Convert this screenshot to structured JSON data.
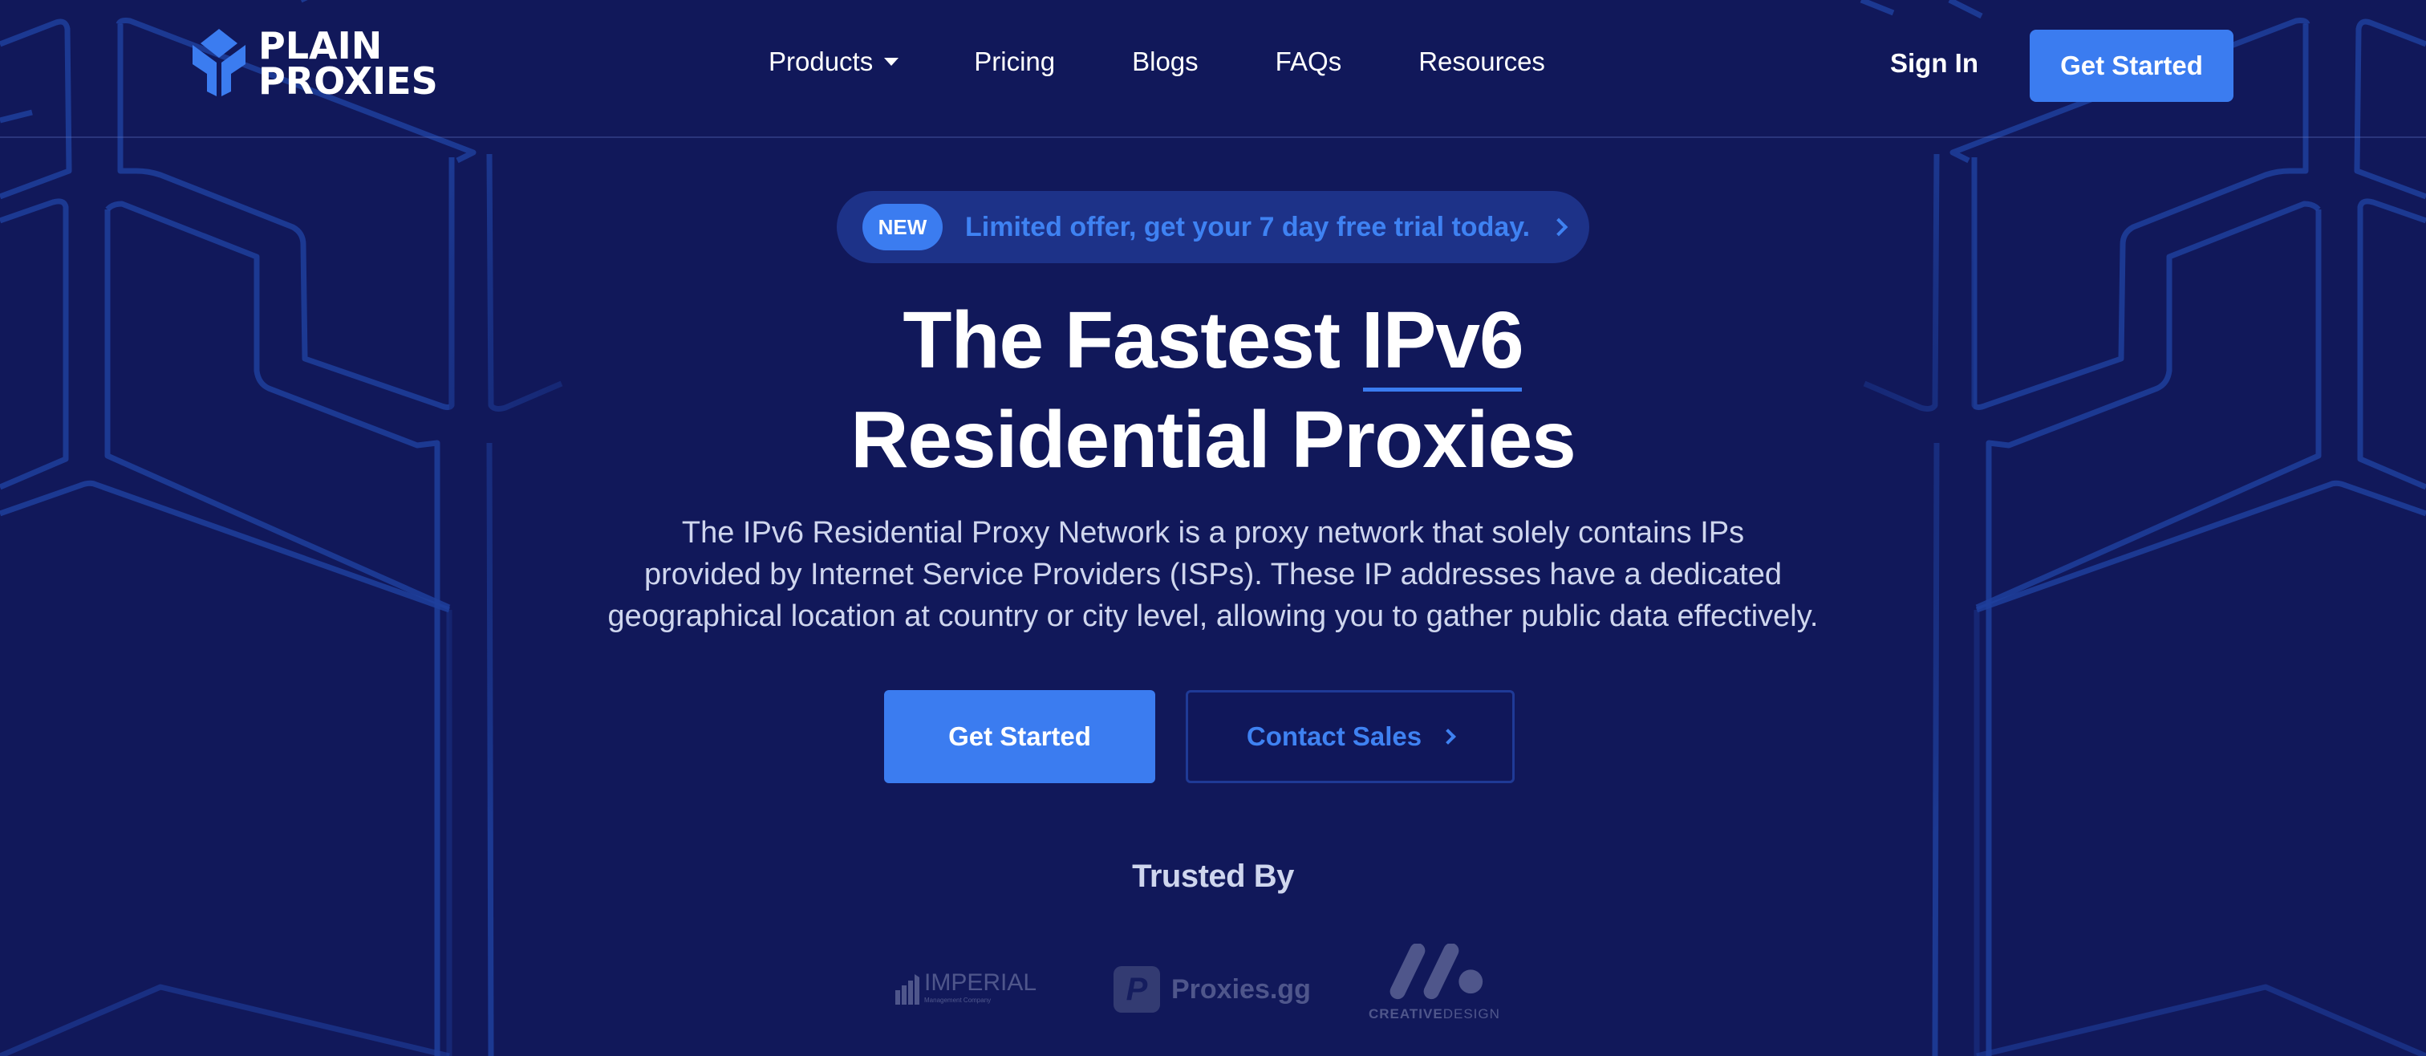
{
  "brand": {
    "name_line1": "PLAIN",
    "name_line2": "PROXIES",
    "accent_color": "#3b7cf0",
    "background_color": "#11185a"
  },
  "nav": {
    "items": [
      {
        "label": "Products",
        "has_dropdown": true
      },
      {
        "label": "Pricing"
      },
      {
        "label": "Blogs"
      },
      {
        "label": "FAQs"
      },
      {
        "label": "Resources"
      }
    ],
    "sign_in_label": "Sign In",
    "get_started_label": "Get Started"
  },
  "promo": {
    "badge": "NEW",
    "text": "Limited offer, get your 7 day free trial today."
  },
  "hero": {
    "headline_part1": "The Fastest ",
    "headline_highlight": "IPv6",
    "headline_line2": "Residential Proxies",
    "description_lines": [
      "The IPv6 Residential Proxy Network is a proxy network that solely contains IPs",
      "provided by Internet Service Providers (ISPs). These IP addresses have a dedicated",
      "geographical location at country or city level, allowing you to gather public data effectively."
    ],
    "primary_cta": "Get Started",
    "secondary_cta": "Contact Sales"
  },
  "trusted": {
    "title": "Trusted By",
    "logos": [
      {
        "name": "IMPERIAL",
        "subtitle": "Management Company"
      },
      {
        "name": "Proxies.gg",
        "tile_letter": "P"
      },
      {
        "name_bold": "CREATIVE",
        "name_light": "DESIGN"
      }
    ]
  }
}
